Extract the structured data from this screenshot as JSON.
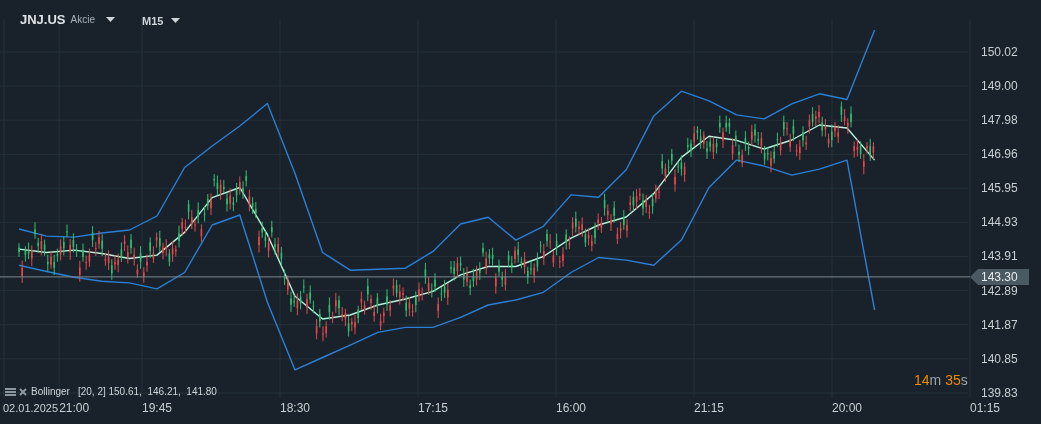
{
  "header": {
    "symbol": "JNJ.US",
    "asset_type": "Akcie",
    "timeframe": "M15"
  },
  "chart": {
    "chart_data": {
      "type": "line",
      "grid": true,
      "categories": [
        null,
        null,
        "21:00",
        null,
        null,
        "19:45",
        null,
        null,
        null,
        null,
        "18:30",
        null,
        null,
        null,
        null,
        "17:15",
        null,
        null,
        null,
        null,
        "16:00",
        null,
        null,
        null,
        null,
        "21:15",
        null,
        null,
        null,
        null,
        "20:00",
        null,
        null,
        null,
        null,
        "01:15"
      ],
      "ylim": [
        139.7,
        151.0
      ],
      "yticks": [
        {
          "value": 150.02,
          "label": "150.02"
        },
        {
          "value": 149,
          "label": "149.00"
        },
        {
          "value": 147.98,
          "label": "147.98"
        },
        {
          "value": 146.96,
          "label": "146.96"
        },
        {
          "value": 145.95,
          "label": "145.95"
        },
        {
          "value": 144.93,
          "label": "144.93"
        },
        {
          "value": 143.91,
          "label": "143.91"
        },
        {
          "value": 142.89,
          "label": "142.89"
        },
        {
          "value": 141.87,
          "label": "141.87"
        },
        {
          "value": 140.85,
          "label": "140.85"
        },
        {
          "value": 139.83,
          "label": "139.83"
        }
      ],
      "series": [
        {
          "color": "#2b7fd6",
          "values": [
            144.73,
            144.52,
            144.49,
            144.61,
            144.7,
            145.12,
            146.57,
            147.21,
            147.81,
            148.48,
            146.39,
            144.03,
            143.5,
            143.53,
            143.56,
            144.06,
            144.88,
            145.08,
            144.4,
            144.81,
            145.75,
            145.68,
            146.5,
            148.11,
            148.85,
            148.56,
            148.14,
            148.02,
            148.47,
            148.77,
            148.6,
            150.68,
            null,
            null,
            null,
            null
          ]
        },
        {
          "color": "#b9f2dc",
          "values": [
            144.13,
            144.03,
            144.1,
            144.0,
            143.85,
            143.95,
            144.63,
            145.67,
            145.97,
            144.56,
            142.72,
            142.04,
            142.16,
            142.46,
            142.64,
            142.87,
            143.36,
            143.61,
            143.61,
            143.91,
            144.46,
            144.85,
            145.09,
            145.79,
            146.87,
            147.5,
            147.38,
            147.12,
            147.39,
            147.84,
            147.75,
            146.79,
            null,
            null,
            null,
            null
          ]
        },
        {
          "color": "#2b7fd6",
          "values": [
            143.65,
            143.46,
            143.29,
            143.17,
            143.12,
            142.94,
            143.43,
            144.85,
            145.15,
            142.54,
            140.52,
            140.89,
            141.26,
            141.64,
            141.79,
            141.79,
            142.09,
            142.46,
            142.61,
            142.84,
            143.43,
            143.88,
            143.8,
            143.65,
            144.4,
            145.97,
            146.79,
            146.61,
            146.34,
            146.52,
            146.79,
            142.31,
            null,
            null,
            null,
            null
          ]
        }
      ]
    },
    "date_label": "02.01.2025",
    "current_price": "143.30"
  },
  "legend": {
    "indicator": "Bollinger",
    "values": "[20, 2] 150.61,  146.21,  141.80"
  },
  "countdown": {
    "minutes": "14",
    "minutes_unit": "m",
    "seconds": "35",
    "seconds_unit": "s"
  }
}
